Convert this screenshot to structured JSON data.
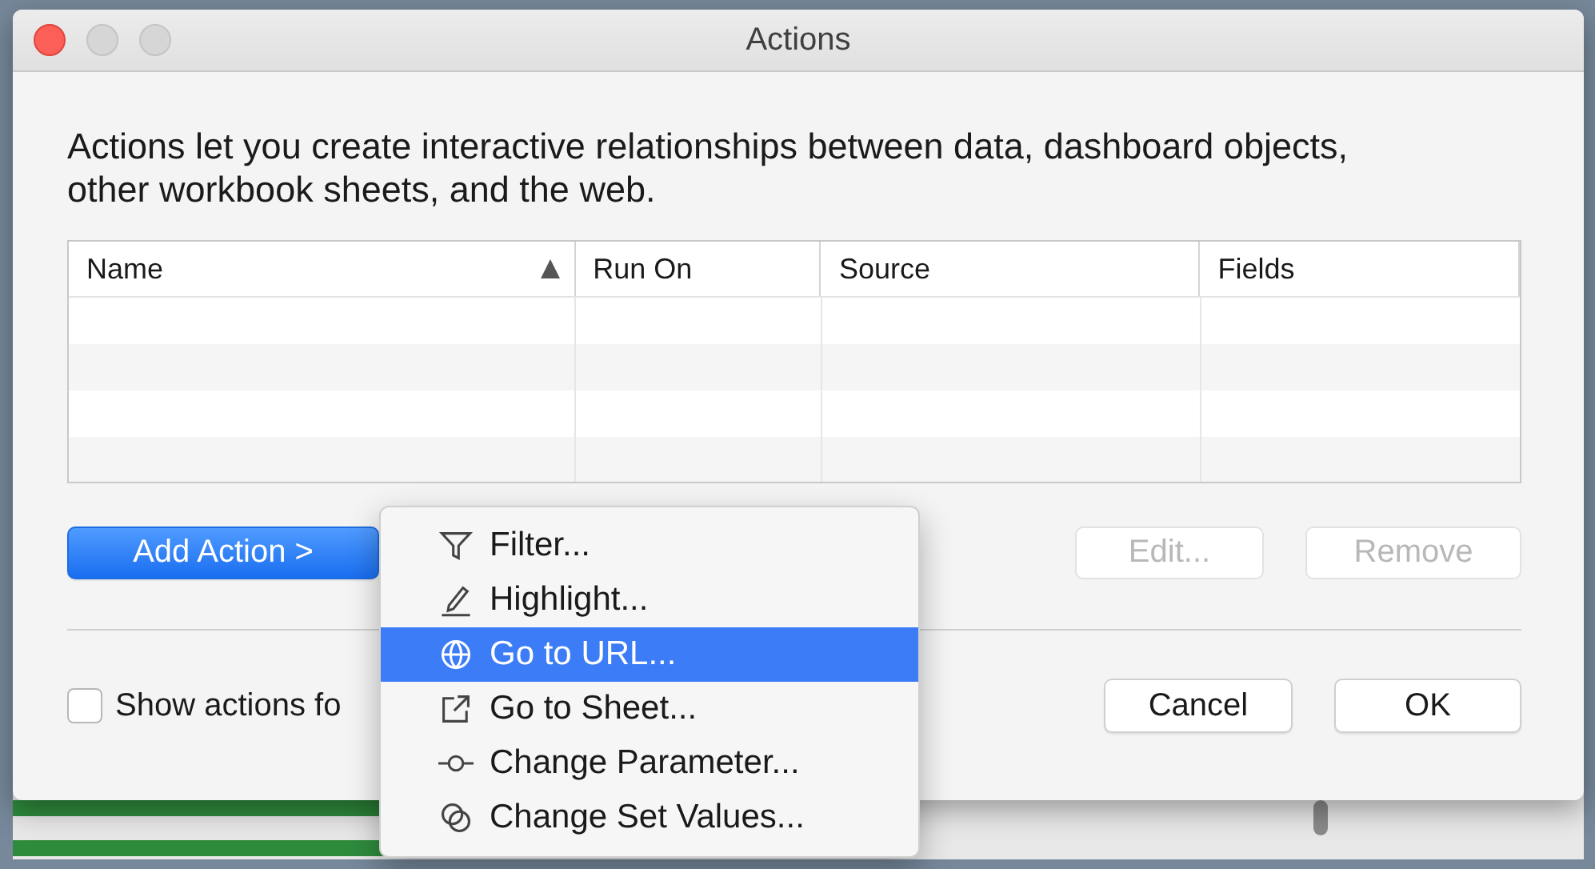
{
  "window": {
    "title": "Actions",
    "active": true
  },
  "description": "Actions let you create interactive relationships between data, dashboard objects, other workbook sheets, and the web.",
  "table": {
    "columns": [
      {
        "label": "Name",
        "sorted": true
      },
      {
        "label": "Run On",
        "sorted": false
      },
      {
        "label": "Source",
        "sorted": false
      },
      {
        "label": "Fields",
        "sorted": false
      }
    ]
  },
  "action_buttons": [
    {
      "label": "Add Action >",
      "kind": "primary",
      "disabled": false
    },
    {
      "label": "Edit...",
      "kind": "normal",
      "disabled": true
    },
    {
      "label": "Remove",
      "kind": "normal",
      "disabled": true
    }
  ],
  "checkbox": {
    "label": "Show actions fo",
    "checked": false
  },
  "dialog_buttons": [
    {
      "label": "Cancel"
    },
    {
      "label": "OK"
    }
  ],
  "menu": {
    "items": [
      {
        "label": "Filter...",
        "kind": "filter",
        "selected": false
      },
      {
        "label": "Highlight...",
        "kind": "highlight",
        "selected": false
      },
      {
        "label": "Go to URL...",
        "kind": "url",
        "selected": true
      },
      {
        "label": "Go to Sheet...",
        "kind": "sheet",
        "selected": false
      },
      {
        "label": "Change Parameter...",
        "kind": "parameter",
        "selected": false
      },
      {
        "label": "Change Set Values...",
        "kind": "set",
        "selected": false
      }
    ]
  }
}
